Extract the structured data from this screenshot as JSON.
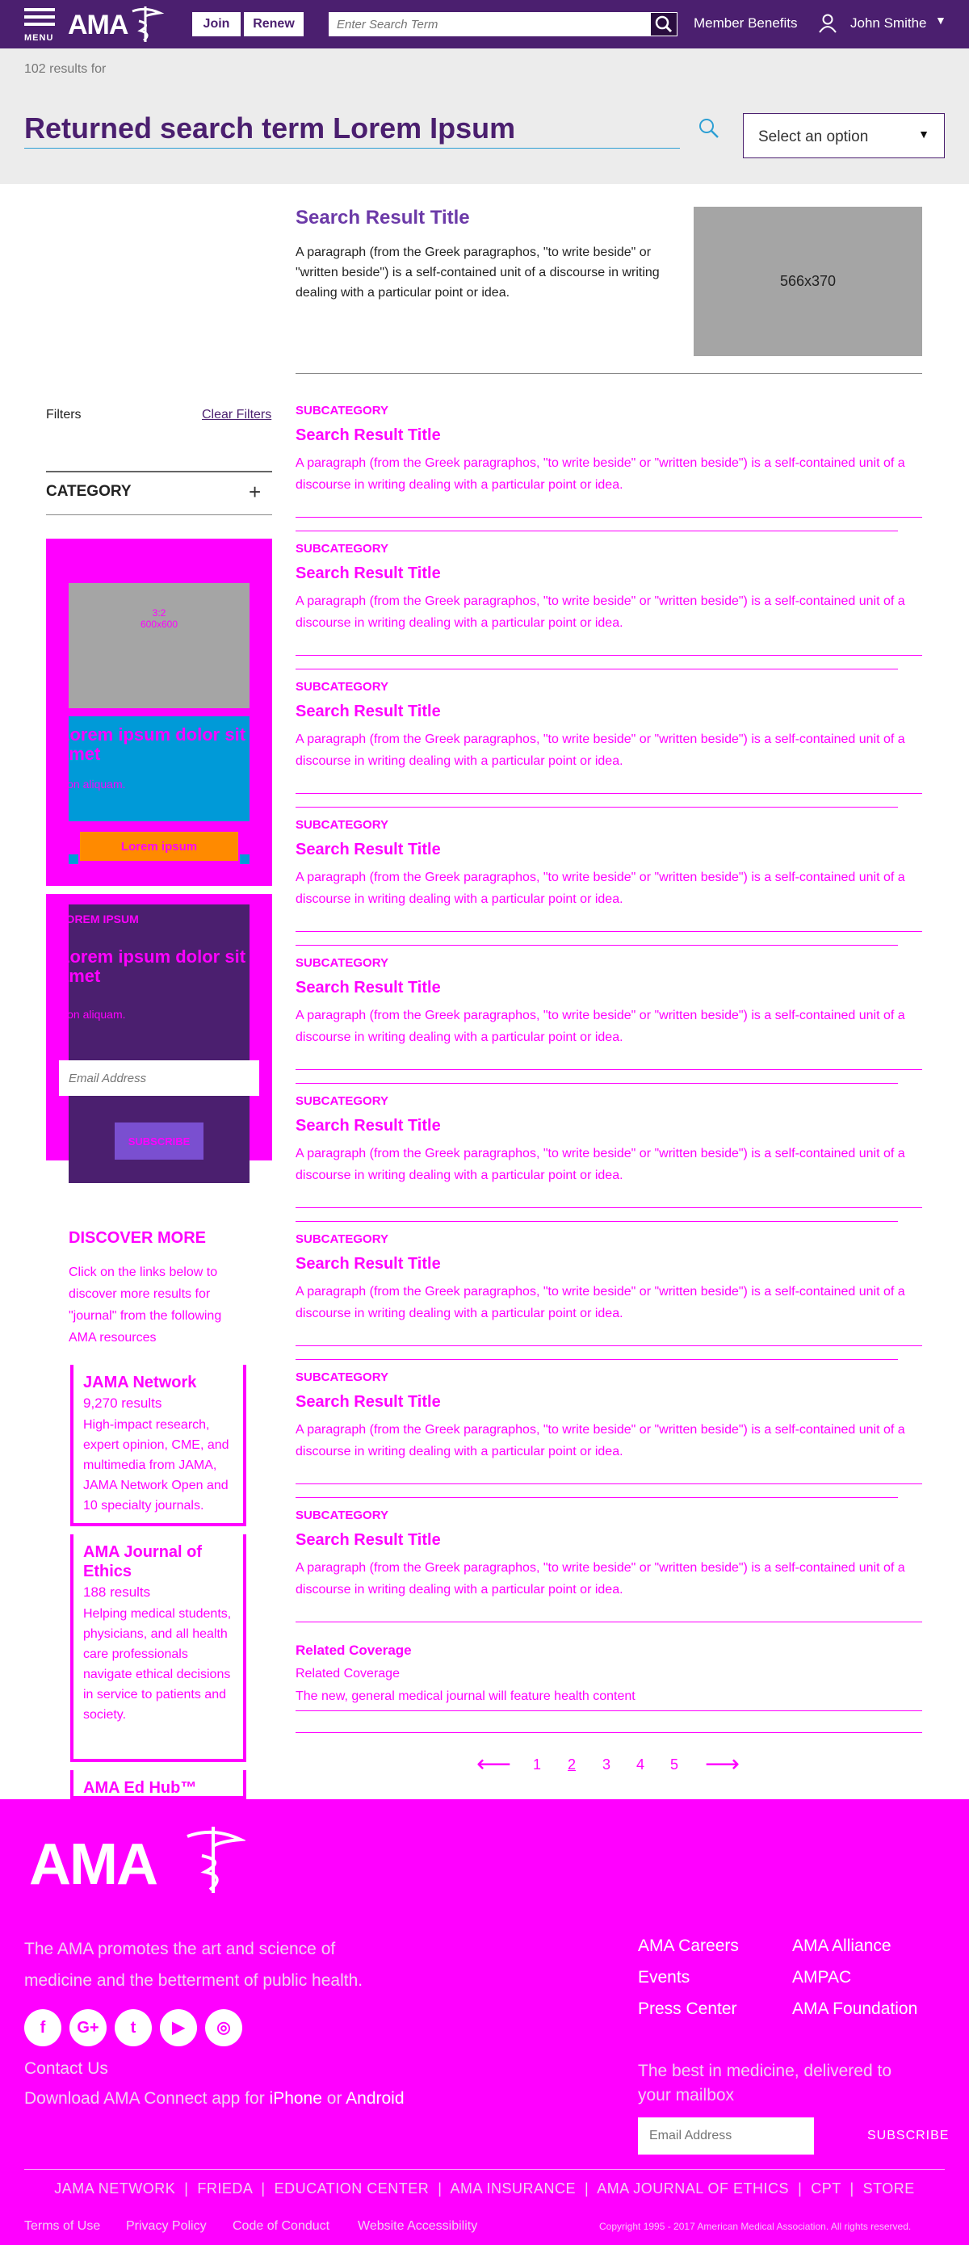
{
  "header": {
    "menu_label": "MENU",
    "logo_text": "AMA",
    "join": "Join",
    "renew": "Renew",
    "search_placeholder": "Enter Search Term",
    "member_benefits": "Member Benefits",
    "user_name": "John Smithe"
  },
  "search": {
    "result_count": "102 results for",
    "query": "Returned search term Lorem Ipsum",
    "sort_value": "Select an option"
  },
  "featured": {
    "title": "Search Result Title",
    "description": "A paragraph (from the Greek paragraphos, \"to write beside\" or \"written beside\") is a self-contained unit of a discourse in writing dealing with a particular point or idea.",
    "image_label": "566x370"
  },
  "filters": {
    "label": "Filters",
    "clear": "Clear Filters",
    "category": "CATEGORY"
  },
  "promo1": {
    "image_label_a": "3:2",
    "image_label_b": "600x600",
    "heading": "Lorem ipsum dolor sit amet",
    "sub": "Non aliquam.",
    "button": "Lorem ipsum"
  },
  "promo2": {
    "eyebrow": "LOREM IPSUM",
    "heading": "Lorem ipsum dolor sit amet",
    "sub": "Non aliquam.",
    "email_placeholder": "Email Address",
    "button": "SUBSCRIBE"
  },
  "discover": {
    "heading": "DISCOVER MORE",
    "text": "Click on the links below to discover more results for \"journal\" from the following AMA resources",
    "cards": [
      {
        "title": "JAMA Network",
        "count": "9,270 results",
        "desc": "High-impact research, expert opinion, CME, and multimedia from JAMA, JAMA Network Open and 10 specialty journals."
      },
      {
        "title": "AMA Journal of Ethics",
        "count": "188 results",
        "desc": "Helping medical students, physicians, and all health care professionals navigate ethical decisions in service to patients and society."
      },
      {
        "title": "AMA Ed Hub™",
        "count": "",
        "desc": ""
      }
    ]
  },
  "results": [
    {
      "subcategory": "SUBCATEGORY",
      "title": "Search Result Title",
      "description": "A paragraph (from the Greek paragraphos, \"to write beside\" or \"written beside\") is a self-contained unit of a discourse in writing dealing with a particular point or idea."
    },
    {
      "subcategory": "SUBCATEGORY",
      "title": "Search Result Title",
      "description": "A paragraph (from the Greek paragraphos, \"to write beside\" or \"written beside\") is a self-contained unit of a discourse in writing dealing with a particular point or idea."
    },
    {
      "subcategory": "SUBCATEGORY",
      "title": "Search Result Title",
      "description": "A paragraph (from the Greek paragraphos, \"to write beside\" or \"written beside\") is a self-contained unit of a discourse in writing dealing with a particular point or idea."
    },
    {
      "subcategory": "SUBCATEGORY",
      "title": "Search Result Title",
      "description": "A paragraph (from the Greek paragraphos, \"to write beside\" or \"written beside\") is a self-contained unit of a discourse in writing dealing with a particular point or idea."
    },
    {
      "subcategory": "SUBCATEGORY",
      "title": "Search Result Title",
      "description": "A paragraph (from the Greek paragraphos, \"to write beside\" or \"written beside\") is a self-contained unit of a discourse in writing dealing with a particular point or idea."
    },
    {
      "subcategory": "SUBCATEGORY",
      "title": "Search Result Title",
      "description": "A paragraph (from the Greek paragraphos, \"to write beside\" or \"written beside\") is a self-contained unit of a discourse in writing dealing with a particular point or idea."
    },
    {
      "subcategory": "SUBCATEGORY",
      "title": "Search Result Title",
      "description": "A paragraph (from the Greek paragraphos, \"to write beside\" or \"written beside\") is a self-contained unit of a discourse in writing dealing with a particular point or idea."
    },
    {
      "subcategory": "SUBCATEGORY",
      "title": "Search Result Title",
      "description": "A paragraph (from the Greek paragraphos, \"to write beside\" or \"written beside\") is a self-contained unit of a discourse in writing dealing with a particular point or idea."
    },
    {
      "subcategory": "SUBCATEGORY",
      "title": "Search Result Title",
      "description": "A paragraph (from the Greek paragraphos, \"to write beside\" or \"written beside\") is a self-contained unit of a discourse in writing dealing with a particular point or idea."
    }
  ],
  "related": {
    "heading": "Related Coverage",
    "link1": "Related Coverage",
    "link2": "The new, general medical journal will feature health content"
  },
  "pagination": {
    "pages": [
      "1",
      "2",
      "3",
      "4",
      "5"
    ],
    "prev": "⟵",
    "next": "⟶"
  },
  "footer": {
    "logo_text": "AMA",
    "tagline": "The AMA promotes the art and science of medicine and the betterment of public health.",
    "social": [
      {
        "icon": "facebook-icon",
        "glyph": "f"
      },
      {
        "icon": "google-plus-icon",
        "glyph": "G+"
      },
      {
        "icon": "twitter-icon",
        "glyph": "t"
      },
      {
        "icon": "youtube-icon",
        "glyph": "▶"
      },
      {
        "icon": "instagram-icon",
        "glyph": "◎"
      }
    ],
    "contact_us": "Contact Us",
    "download_prefix": "Download AMA Connect app for",
    "download_iphone": "iPhone",
    "download_or": "or",
    "download_android": "Android",
    "links_col1": [
      "AMA Careers",
      "Events",
      "Press Center"
    ],
    "links_col2": [
      "AMA Alliance",
      "AMPAC",
      "AMA Foundation"
    ],
    "newsletter_heading": "The best in medicine, delivered to your mailbox",
    "newsletter_placeholder": "Email Address",
    "newsletter_button": "SUBSCRIBE",
    "nav": [
      "JAMA NETWORK",
      "FRIEDA",
      "EDUCATION CENTER",
      "AMA INSURANCE",
      "AMA JOURNAL OF ETHICS",
      "CPT",
      "STORE"
    ],
    "legal": [
      "Terms of Use",
      "Privacy Policy",
      "Code of Conduct",
      "Website Accessibility"
    ],
    "copyright": "Copyright 1995 - 2017 American Medical Association. All rights reserved."
  },
  "colors": {
    "brand_purple": "#4b1f6f",
    "accent_magenta": "#ff00ff",
    "accent_blue": "#009ad8",
    "accent_orange": "#ff8a00"
  }
}
